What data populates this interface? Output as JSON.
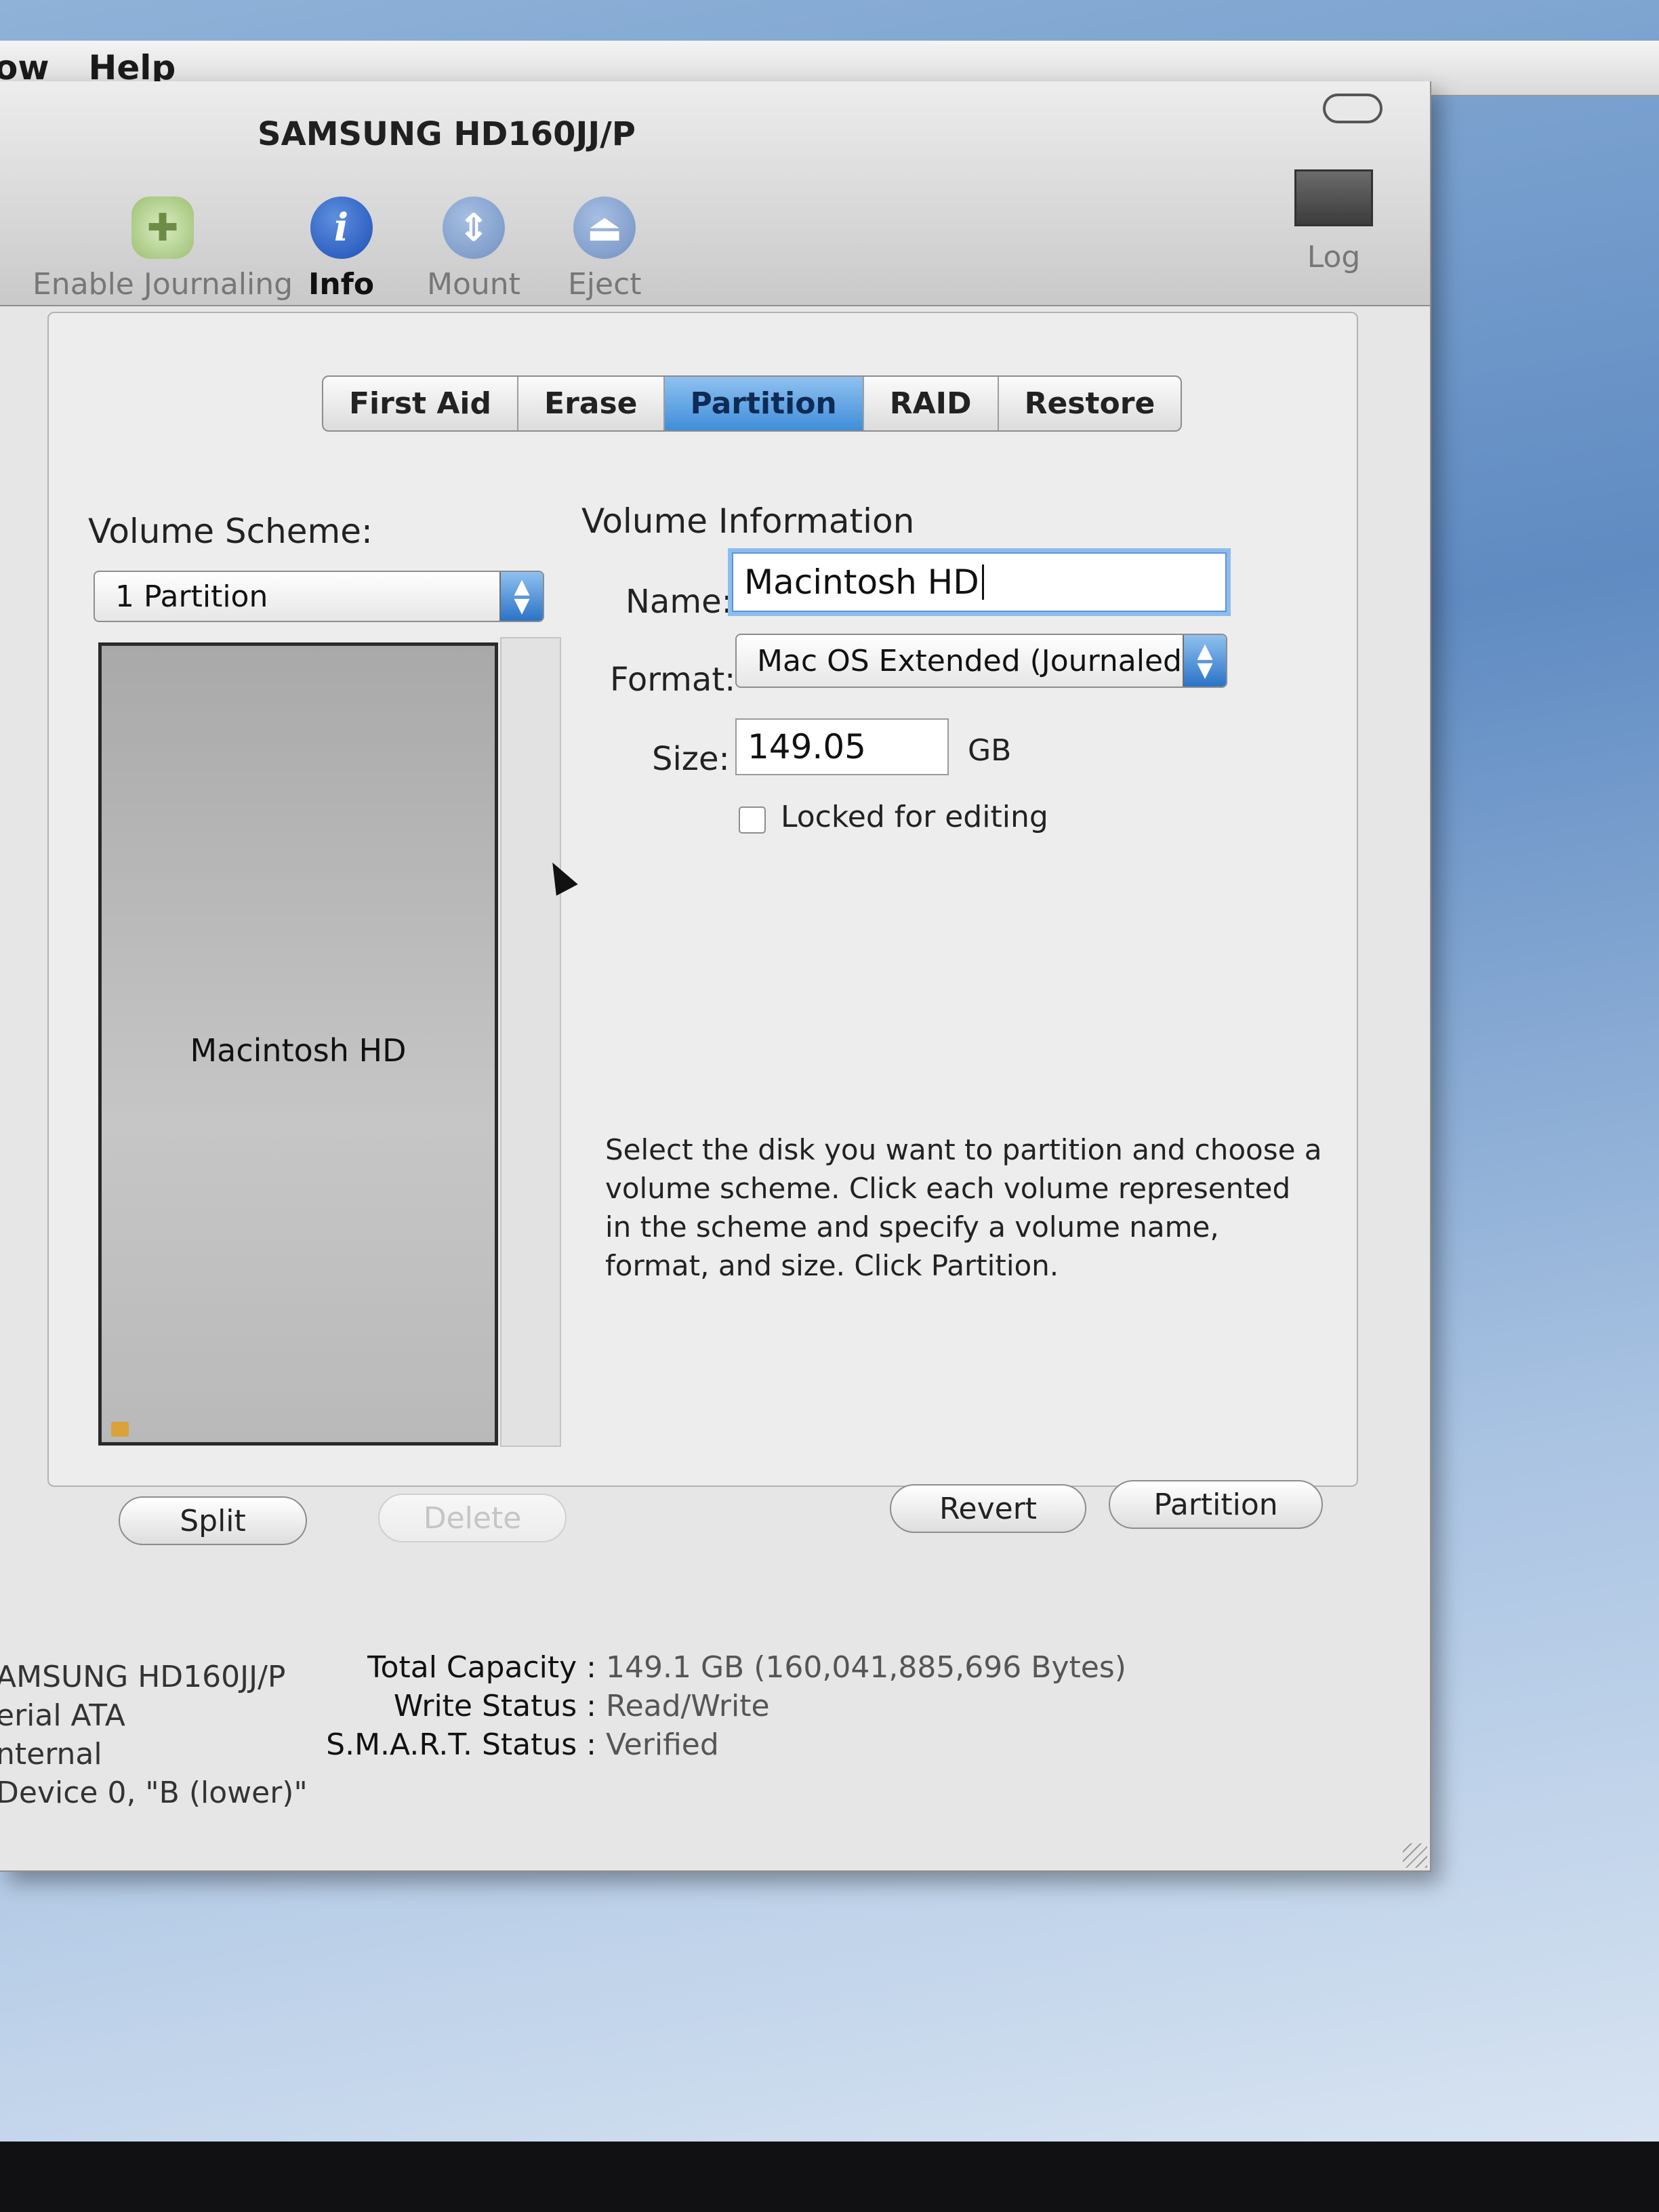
{
  "menubar": {
    "items": [
      "ow",
      "Help"
    ]
  },
  "window": {
    "title": "SAMSUNG HD160JJ/P",
    "toolbar": {
      "journaling": "Enable Journaling",
      "info": "Info",
      "mount": "Mount",
      "eject": "Eject",
      "log": "Log"
    }
  },
  "tabs": [
    "First Aid",
    "Erase",
    "Partition",
    "RAID",
    "Restore"
  ],
  "selected_tab": "Partition",
  "volume_scheme": {
    "label": "Volume Scheme:",
    "selected": "1 Partition",
    "volume_name": "Macintosh HD"
  },
  "volume_info": {
    "heading": "Volume Information",
    "name_label": "Name:",
    "name_value": "Macintosh HD",
    "format_label": "Format:",
    "format_value": "Mac OS Extended (Journaled)",
    "size_label": "Size:",
    "size_value": "149.05",
    "size_unit": "GB",
    "locked_label": "Locked for editing",
    "locked": false
  },
  "help_text": "Select the disk you want to partition and choose a volume scheme. Click each volume represented in the scheme and specify a volume name, format, and size. Click Partition.",
  "buttons": {
    "split": "Split",
    "delete": "Delete",
    "revert": "Revert",
    "partition": "Partition"
  },
  "disk_info": {
    "left": [
      "AMSUNG HD160JJ/P",
      "erial ATA",
      "nternal",
      "Device 0, \"B (lower)\""
    ],
    "capacity_label": "Total Capacity :",
    "capacity_value": "149.1 GB (160,041,885,696 Bytes)",
    "write_label": "Write Status :",
    "write_value": "Read/Write",
    "smart_label": "S.M.A.R.T. Status :",
    "smart_value": "Verified"
  },
  "colors": {
    "accent": "#3f8ed9",
    "info_icon": "#1d4fb5"
  },
  "icons": {
    "journaling": "journaling-icon",
    "info": "info-icon",
    "mount": "mount-icon",
    "eject": "eject-icon",
    "log": "log-icon"
  }
}
